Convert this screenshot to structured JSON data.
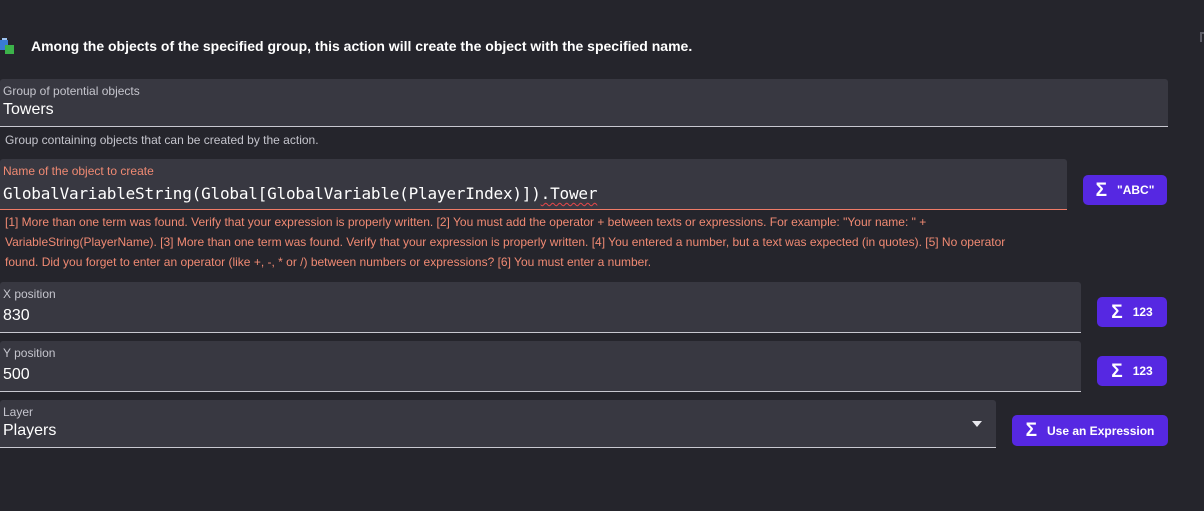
{
  "header": {
    "icon": "object-group-icon",
    "description": "Among the objects of the specified group, this action will create the object with the specified name."
  },
  "group_field": {
    "label": "Group of potential objects",
    "value": "Towers",
    "helper": "Group containing objects that can be created by the action."
  },
  "name_field": {
    "label": "Name of the object to create",
    "value_main": "GlobalVariableString(Global[GlobalVariable(PlayerIndex)])",
    "value_error": ".Tower",
    "error_line1": "[1] More than one term was found. Verify that your expression is properly written. [2] You must add the operator + between texts or expressions. For example: \"Your name: \" +",
    "error_line2": "VariableString(PlayerName). [3] More than one term was found. Verify that your expression is properly written. [4] You entered a number, but a text was expected (in quotes). [5] No operator",
    "error_line3": "found. Did you forget to enter an operator (like +, -, * or /) between numbers or expressions? [6] You must enter a number.",
    "button_label": "\"ABC\""
  },
  "x_field": {
    "label": "X position",
    "value": "830",
    "button_label": "123"
  },
  "y_field": {
    "label": "Y position",
    "value": "500",
    "button_label": "123"
  },
  "layer_field": {
    "label": "Layer",
    "value": "Players",
    "button_label": "Use an Expression"
  },
  "sigma_symbol": "Σ",
  "colors": {
    "background": "#25252c",
    "field": "#383841",
    "accent": "#5628e2",
    "error": "#f08a73"
  }
}
